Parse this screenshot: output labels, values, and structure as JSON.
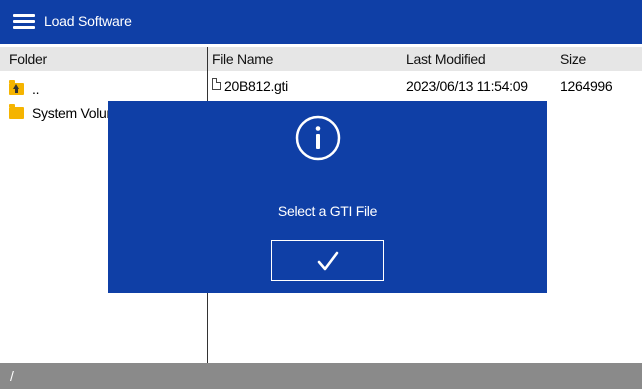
{
  "titlebar": {
    "title": "Load Software",
    "menu_icon": "hamburger-menu-icon"
  },
  "columns": {
    "folder": "Folder",
    "file_name": "File Name",
    "last_modified": "Last Modified",
    "size": "Size"
  },
  "folders": [
    {
      "name": "..",
      "icon": "folder-up-icon"
    },
    {
      "name": "System Volume Information",
      "icon": "folder-icon"
    }
  ],
  "files": [
    {
      "name": "20B812.gti",
      "last_modified": "2023/06/13 11:54:09",
      "size": "1264996",
      "icon": "file-icon"
    }
  ],
  "status": {
    "path": "/"
  },
  "dialog": {
    "icon": "info-icon",
    "message": "Select a GTI File",
    "ok_icon": "checkmark-icon"
  },
  "colors": {
    "primary": "#0f3fa6",
    "header_bg": "#e6e6e6",
    "status_bg": "#8a8a8a",
    "folder": "#f5b400"
  }
}
